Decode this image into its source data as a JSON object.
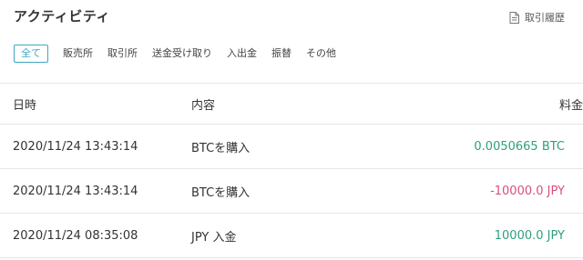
{
  "header": {
    "title": "アクティビティ",
    "history_link": "取引履歴",
    "history_icon": "document-icon"
  },
  "tabs": [
    {
      "label": "全て",
      "active": true
    },
    {
      "label": "販売所",
      "active": false
    },
    {
      "label": "取引所",
      "active": false
    },
    {
      "label": "送金受け取り",
      "active": false
    },
    {
      "label": "入出金",
      "active": false
    },
    {
      "label": "振替",
      "active": false
    },
    {
      "label": "その他",
      "active": false
    }
  ],
  "table": {
    "columns": [
      "日時",
      "内容",
      "料金"
    ],
    "rows": [
      {
        "datetime": "2020/11/24 13:43:14",
        "content": "BTCを購入",
        "amount": "0.0050665 BTC",
        "sign": "positive"
      },
      {
        "datetime": "2020/11/24 13:43:14",
        "content": "BTCを購入",
        "amount": "-10000.0 JPY",
        "sign": "negative"
      },
      {
        "datetime": "2020/11/24 08:35:08",
        "content": "JPY 入金",
        "amount": "10000.0 JPY",
        "sign": "positive"
      }
    ]
  },
  "colors": {
    "accent": "#3ea7c4",
    "positive": "#2f9e7e",
    "negative": "#d9507a"
  }
}
